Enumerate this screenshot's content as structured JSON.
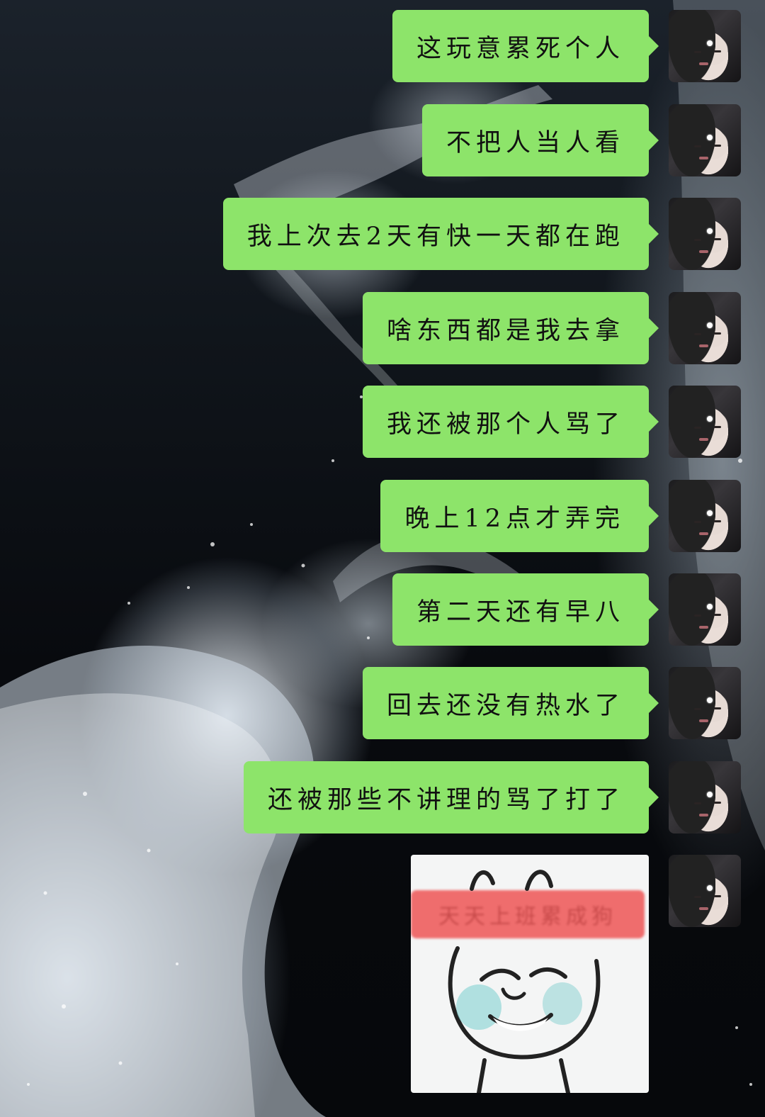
{
  "messages": [
    {
      "text": "这玩意累死个人"
    },
    {
      "text": "不把人当人看"
    },
    {
      "text": "我上次去2天有快一天都在跑"
    },
    {
      "text": "啥东西都是我去拿"
    },
    {
      "text": "我还被那个人骂了"
    },
    {
      "text": "晚上12点才弄完"
    },
    {
      "text": "第二天还有早八"
    },
    {
      "text": "回去还没有热水了"
    },
    {
      "text": "还被那些不讲理的骂了打了"
    }
  ],
  "sticker": {
    "icon": "meme-face-sticker",
    "banner_text": "天天上班累成狗"
  },
  "colors": {
    "bubble": "#8de46a",
    "text": "#111111"
  }
}
